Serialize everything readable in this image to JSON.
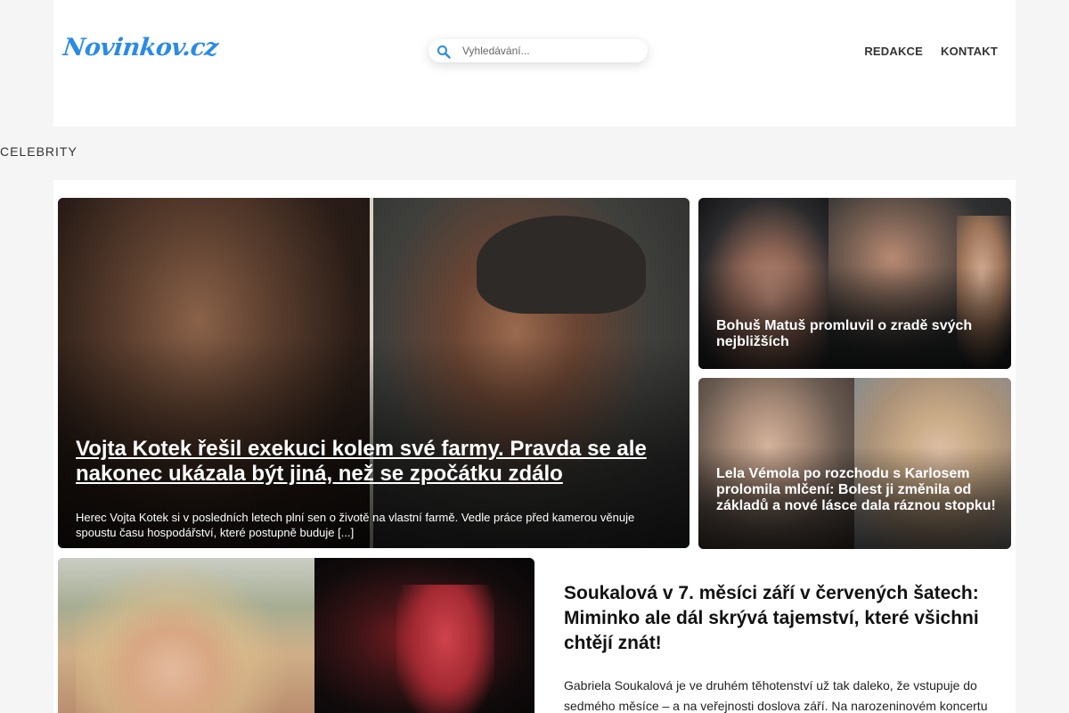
{
  "header": {
    "logo_text": "Novinkov.cz",
    "search_placeholder": "Vyhledávání...",
    "nav": [
      "REDAKCE",
      "KONTAKT"
    ]
  },
  "category": "CELEBRITY",
  "featured": {
    "title": "Vojta Kotek řešil exekuci kolem své farmy. Pravda se ale nakonec ukázala být jiná, než se zpočátku zdálo",
    "excerpt": "Herec Vojta Kotek si v posledních letech plní sen o životě na vlastní farmě. Vedle práce před kamerou věnuje spoustu času hospodářství, které postupně buduje [...]"
  },
  "side_cards": [
    {
      "title": "Bohuš Matuš promluvil o zradě svých nejbližších"
    },
    {
      "title": "Lela Vémola po rozchodu s Karlosem prolomila mlčení: Bolest ji změnila od základů a nové lásce dala ráznou stopku!"
    }
  ],
  "article": {
    "title": "Soukalová v 7. měsíci září v červených šatech: Miminko ale dál skrývá tajemství, které všichni chtějí znát!",
    "excerpt": "Gabriela Soukalová je ve druhém těhotenství už tak daleko, že vstupuje do sedmého měsíce – a na veřejnosti doslova září. Na narozeninovém koncertu"
  },
  "colors": {
    "logo": "#2a8be6",
    "search_icon": "#2a8be6"
  }
}
